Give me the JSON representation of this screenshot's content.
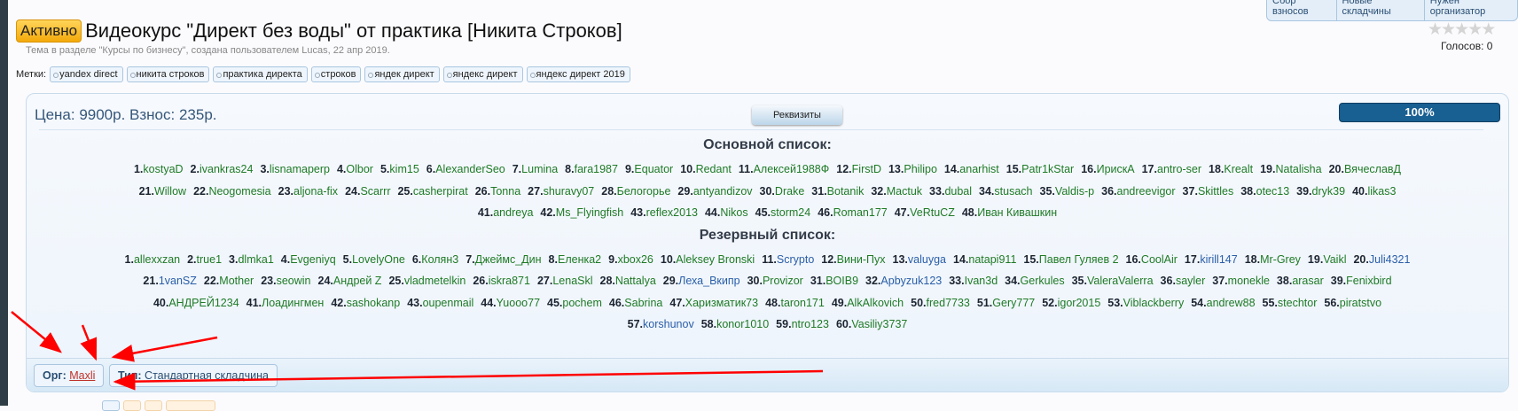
{
  "top_tabs": [
    "Сбор взносов",
    "Новые складчины",
    "Нужен организатор"
  ],
  "status_badge": "Активно",
  "title": "Видеокурс \"Директ без воды\" от практика [Никита Строков]",
  "meta": "Тема в разделе \"Курсы по бизнесу\", создана пользователем Lucas, 22 апр 2019.",
  "tags_label": "Метки:",
  "tags": [
    "yandex direct",
    "никита строков",
    "практика директа",
    "строков",
    "яндек директ",
    "яндекс директ",
    "яндекс директ 2019"
  ],
  "rating": {
    "stars": 0,
    "max": 5,
    "votes_text": "Голосов: 0"
  },
  "price_text": "Цена: 9900р.  Взнос: 235р.",
  "requisites_button": "Реквизиты",
  "progress": {
    "percent": 100,
    "label": "100%"
  },
  "main_list": {
    "title": "Основной список:",
    "rows": [
      [
        "kostyaD",
        "ivankras24",
        "lisnamaperp",
        "Olbor",
        "kim15",
        "AlexanderSeo",
        "Lumina",
        "fara1987",
        "Equator",
        "Redant",
        "Алексей1988Ф",
        "FirstD",
        "Philipo",
        "anarhist",
        "Patr1kStar",
        "ИрискА",
        "antro-ser",
        "Krealt",
        "Natalisha",
        "ВячеславД"
      ],
      [
        "Willow",
        "Neogomesia",
        "aljona-fix",
        "Scarrr",
        "casherpirat",
        "Tonna",
        "shuravy07",
        "Белогорье",
        "antyandizov",
        "Drake",
        "Botanik",
        "Mactuk",
        "dubal",
        "stusach",
        "Valdis-p",
        "andreevigor",
        "Skittles",
        "otec13",
        "dryk39",
        "likas3"
      ],
      [
        "andreya",
        "Ms_Flyingfish",
        "reflex2013",
        "Nikos",
        "storm24",
        "Roman177",
        "VeRtuCZ",
        "Иван Кивашкин"
      ]
    ]
  },
  "reserve_list": {
    "title": "Резервный список:",
    "rows": [
      [
        "allexxzan",
        "true1",
        "dlmka1",
        "Evgeniyq",
        "LovelyOne",
        "Колян3",
        "Джеймс_Дин",
        "Еленка2",
        "xbox26",
        "Aleksey Bronski",
        "Scrypto",
        "Вини-Пух",
        "valuyga",
        "natapi911",
        "Павел Гуляев 2",
        "CoolAir",
        "kirill147",
        "Mr-Grey",
        "Vaikl",
        "Juli4321"
      ],
      [
        "1vanSZ",
        "Mother",
        "seowin",
        "Андрей Z",
        "vladmetelkin",
        "iskra871",
        "LenaSkl",
        "Nattalya",
        "Леха_Вкипр",
        "Provizor",
        "BOIB9",
        "Apbyzuk123",
        "Ivan3d",
        "Gerkules",
        "ValeraValerra",
        "sayler",
        "monekle",
        "arasar",
        "Fenixbird"
      ],
      [
        "АНДРЕЙ1234",
        "Лоадингмен",
        "sashokanp",
        "oupenmail",
        "Yuooo77",
        "pochem",
        "Sabrina",
        "Харизматик73",
        "taron171",
        "AlkAlkovich",
        "fred7733",
        "Gery777",
        "igor2015",
        "Viblackberry",
        "andrew88",
        "stechtor",
        "piratstvo"
      ],
      [
        "korshunov",
        "konor1010",
        "ntro123",
        "Vasiliy3737"
      ]
    ],
    "blue_names": [
      "1vanSZ",
      "Леха_Вкипр",
      "Apbyzuk123",
      "kirill147",
      "Juli4321",
      "korshunov",
      "valuyga",
      "Scrypto"
    ]
  },
  "footer": {
    "org_label": "Орг:",
    "org_name": "Maxli",
    "type_label": "Тип:",
    "type_value": "Стандартная складчина"
  },
  "colors": {
    "accent": "#185f92",
    "name_green": "#1f7a26",
    "arrow": "#ff0000"
  }
}
